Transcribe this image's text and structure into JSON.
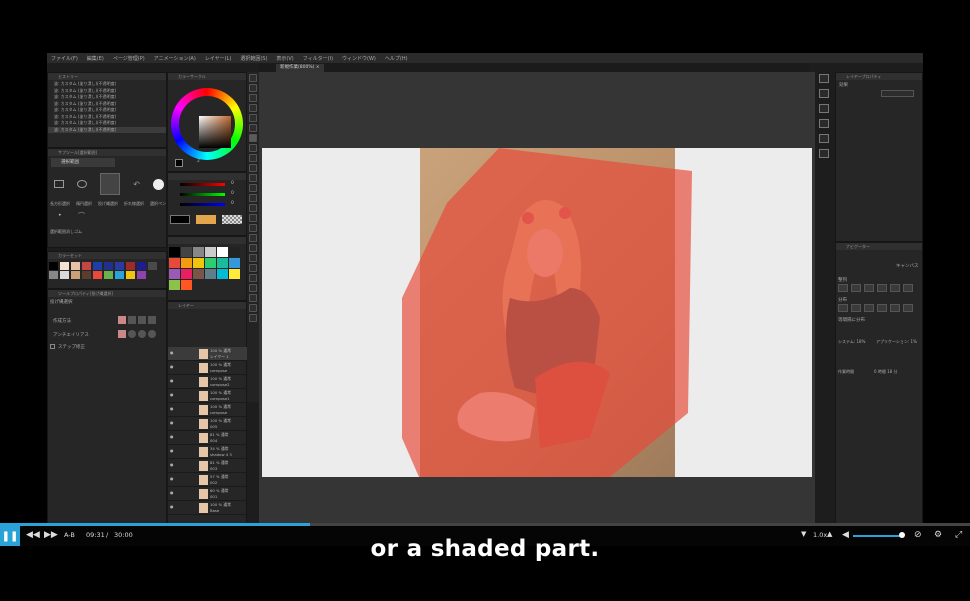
{
  "app": {
    "menu": [
      "ファイル(F)",
      "編集(E)",
      "ページ管理(P)",
      "アニメーション(A)",
      "レイヤー(L)",
      "選択範囲(S)",
      "表示(V)",
      "フィルター(I)",
      "ウィンドウ(W)",
      "ヘルプ(H)"
    ],
    "document_tab": "新規作業(800%) ×"
  },
  "history": {
    "title": "ヒストリー",
    "items": [
      "塗: カスタム (塗り潰し)(不透明度)",
      "塗: カスタム (塗り潰し)(不透明度)",
      "塗: カスタム (塗り潰し)(不透明度)",
      "塗: カスタム (塗り潰し)(不透明度)",
      "塗: カスタム (塗り潰し)(不透明度)",
      "塗: カスタム (塗り潰し)(不透明度)",
      "塗: カスタム (塗り潰し)(不透明度)",
      "塗: カスタム (塗り潰し)(不透明度)"
    ]
  },
  "subtool": {
    "title": "サブツール[選択範囲]",
    "group": "選択範囲",
    "labels": [
      "長方形選択",
      "楕円選択",
      "投げ縄選択",
      "折れ線選択",
      "選択ペン"
    ],
    "extra": "選択範囲消しゴム"
  },
  "color_set": {
    "title": "カラーセット"
  },
  "tool_property": {
    "title": "ツールプロパティ[投げ縄選択]",
    "subtitle": "投げ縄選択",
    "rows": [
      "作成方法",
      "アンチエイリアス",
      "ステップ修正"
    ]
  },
  "layer_panel": {
    "title": "レイヤー",
    "layers": [
      {
        "pct": "100 % 通常",
        "name": "レイヤー 1"
      },
      {
        "pct": "100 % 通常",
        "name": "compose"
      },
      {
        "pct": "100 % 通常",
        "name": "compose2"
      },
      {
        "pct": "100 % 通常",
        "name": "compose1"
      },
      {
        "pct": "100 % 通常",
        "name": "compose"
      },
      {
        "pct": "100 % 通常",
        "name": "005"
      },
      {
        "pct": "81 % 通常",
        "name": "004"
      },
      {
        "pct": "34 % 通常",
        "name": "shadow 4 3"
      },
      {
        "pct": "81 % 通常",
        "name": "003"
      },
      {
        "pct": "57 % 通常",
        "name": "002"
      },
      {
        "pct": "60 % 通常",
        "name": "001"
      },
      {
        "pct": "100 % 通常",
        "name": "Base"
      }
    ]
  },
  "color_panel": {
    "title": "カラーサークル",
    "value": "2",
    "sliders": [
      "0",
      "0",
      "0"
    ]
  },
  "right_panel": {
    "title": "レイヤープロパティ",
    "tab": "効果",
    "nav_title": "ナビゲーター",
    "nav_labels": [
      "キャンバス",
      "整列",
      "分布",
      "等間隔に分布"
    ],
    "stats": [
      "システム: 18%",
      "アプリケーション: 1%"
    ],
    "work_time_label": "作業時間",
    "work_time_value": "0 時間 18 分"
  },
  "player": {
    "current_time": "09:31",
    "separator": "/",
    "total_time": "30:00",
    "ab_label": "A-B",
    "speed": "1.0x",
    "progress": 0.32,
    "volume": 0.9,
    "subtitle": "or a shaded part."
  },
  "colors": {
    "accent": "#2aa3d8",
    "overlay_red": "#e8493a"
  }
}
